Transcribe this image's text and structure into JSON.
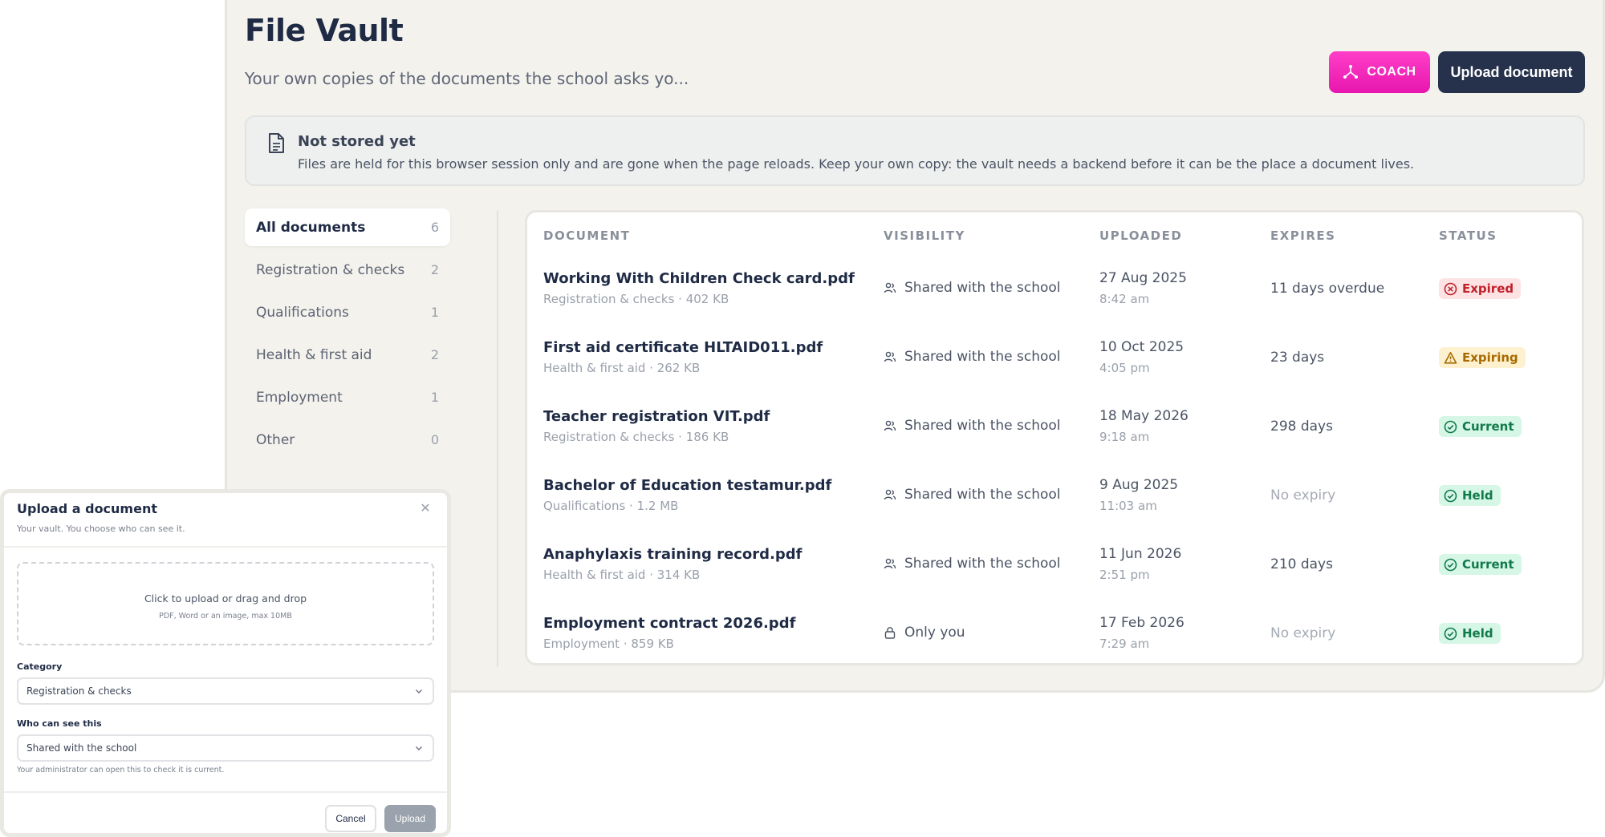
{
  "header": {
    "title": "File Vault",
    "subtitle": "Your own copies of the documents the school asks yo...",
    "coach_label": "COACH",
    "upload_label": "Upload document"
  },
  "notice": {
    "title": "Not stored yet",
    "body": "Files are held for this browser session only and are gone when the page reloads. Keep your own copy: the vault needs a backend before it can be the place a document lives."
  },
  "sidebar": {
    "items": [
      {
        "label": "All documents",
        "count": "6"
      },
      {
        "label": "Registration & checks",
        "count": "2"
      },
      {
        "label": "Qualifications",
        "count": "1"
      },
      {
        "label": "Health & first aid",
        "count": "2"
      },
      {
        "label": "Employment",
        "count": "1"
      },
      {
        "label": "Other",
        "count": "0"
      }
    ]
  },
  "table": {
    "headers": {
      "document": "DOCUMENT",
      "visibility": "VISIBILITY",
      "uploaded": "UPLOADED",
      "expires": "EXPIRES",
      "status": "STATUS"
    },
    "rows": [
      {
        "name": "Working With Children Check card.pdf",
        "meta": "Registration & checks · 402 KB",
        "visibility": "Shared with the school",
        "date": "27 Aug 2025",
        "time": "8:42 am",
        "expires": "11 days overdue",
        "status": "Expired"
      },
      {
        "name": "First aid certificate HLTAID011.pdf",
        "meta": "Health & first aid · 262 KB",
        "visibility": "Shared with the school",
        "date": "10 Oct 2025",
        "time": "4:05 pm",
        "expires": "23 days",
        "status": "Expiring"
      },
      {
        "name": "Teacher registration VIT.pdf",
        "meta": "Registration & checks · 186 KB",
        "visibility": "Shared with the school",
        "date": "18 May 2026",
        "time": "9:18 am",
        "expires": "298 days",
        "status": "Current"
      },
      {
        "name": "Bachelor of Education testamur.pdf",
        "meta": "Qualifications · 1.2 MB",
        "visibility": "Shared with the school",
        "date": "9 Aug 2025",
        "time": "11:03 am",
        "expires": "No expiry",
        "status": "Held"
      },
      {
        "name": "Anaphylaxis training record.pdf",
        "meta": "Health & first aid · 314 KB",
        "visibility": "Shared with the school",
        "date": "11 Jun 2026",
        "time": "2:51 pm",
        "expires": "210 days",
        "status": "Current"
      },
      {
        "name": "Employment contract 2026.pdf",
        "meta": "Employment · 859 KB",
        "visibility": "Only you",
        "date": "17 Feb 2026",
        "time": "7:29 am",
        "expires": "No expiry",
        "status": "Held"
      }
    ]
  },
  "dialog": {
    "title": "Upload a document",
    "subtitle": "Your vault. You choose who can see it.",
    "dropzone_main": "Click to upload or drag and drop",
    "dropzone_hint": "PDF, Word or an image, max 10MB",
    "category_label": "Category",
    "category_value": "Registration & checks",
    "visibility_label": "Who can see this",
    "visibility_value": "Shared with the school",
    "help": "Your administrator can open this to check it is current.",
    "cancel_label": "Cancel",
    "submit_label": "Upload"
  },
  "colors": {
    "brand_navy": "#26324c",
    "coach_pink": "#e716ae",
    "expired_red": "#c1212b",
    "expiring_amber": "#a86a00",
    "ok_green": "#117a4a"
  }
}
